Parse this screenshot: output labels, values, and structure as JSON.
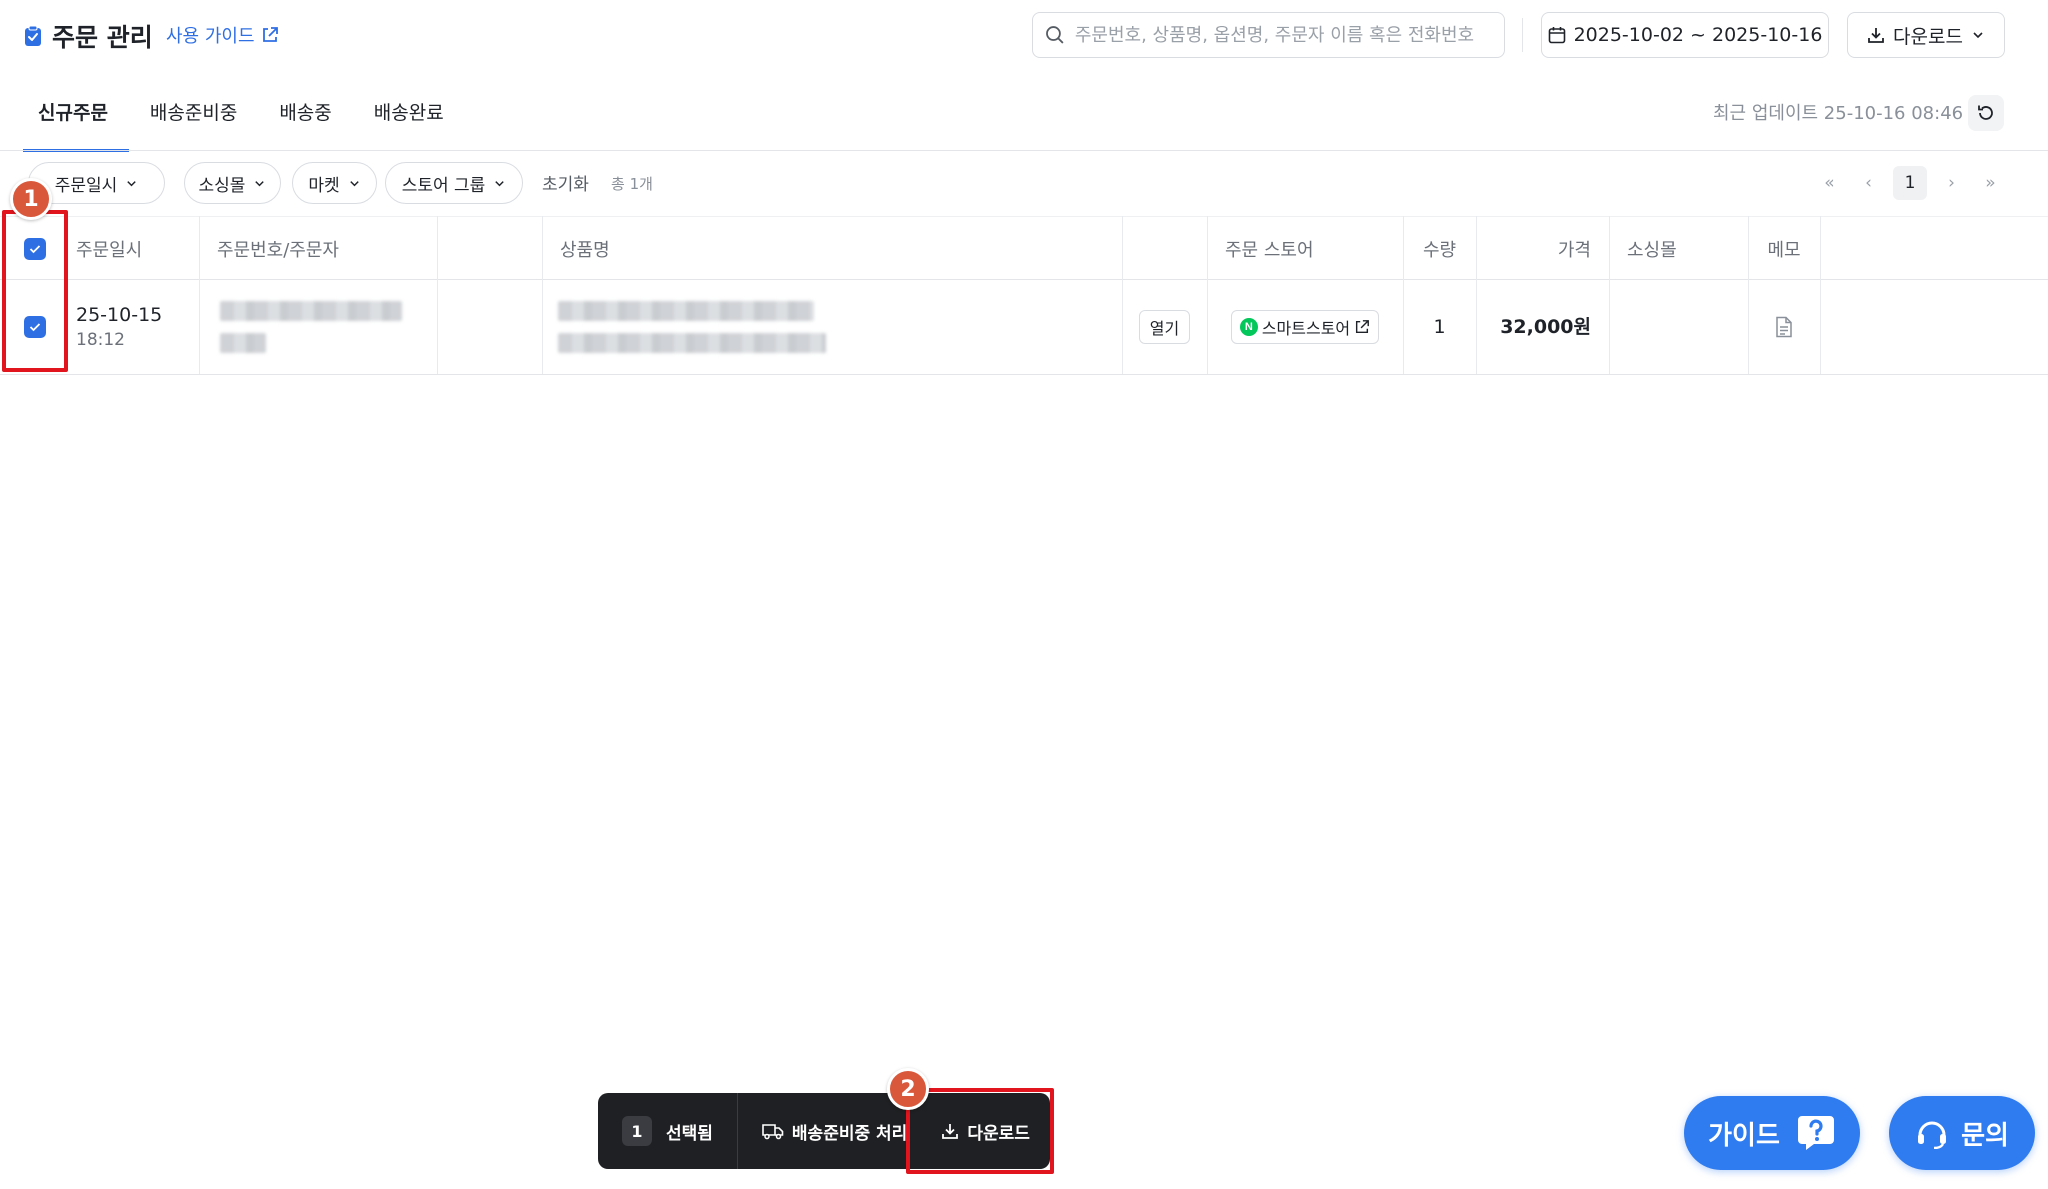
{
  "header": {
    "title": "주문 관리",
    "guide_link": "사용 가이드",
    "search_placeholder": "주문번호, 상품명, 옵션명, 주문자 이름 혹은 전화번호",
    "date_range": "2025-10-02 ~ 2025-10-16",
    "download_label": "다운로드"
  },
  "tabs": [
    {
      "label": "신규주문",
      "active": true
    },
    {
      "label": "배송준비중",
      "active": false
    },
    {
      "label": "배송중",
      "active": false
    },
    {
      "label": "배송완료",
      "active": false
    }
  ],
  "last_updated": "최근 업데이트 25-10-16 08:46",
  "filters": {
    "chips": [
      "주문일시",
      "소싱몰",
      "마켓",
      "스토어 그룹"
    ],
    "reset_label": "초기화",
    "total_label": "총 1개"
  },
  "pagination": {
    "current_page": "1",
    "first": "«",
    "prev": "‹",
    "next": "›",
    "last": "»"
  },
  "table": {
    "columns": [
      "주문일시",
      "주문번호/주문자",
      "",
      "상품명",
      "",
      "주문 스토어",
      "수량",
      "가격",
      "소싱몰",
      "메모"
    ],
    "rows": [
      {
        "date": "25-10-15",
        "time": "18:12",
        "open_label": "열기",
        "store": "스마트스토어",
        "store_logo": "N",
        "quantity": "1",
        "price": "32,000원"
      }
    ]
  },
  "action_bar": {
    "selected_count": "1",
    "selected_label": "선택됨",
    "ship_prep_label": "배송준비중 처리",
    "download_label": "다운로드"
  },
  "annotations": {
    "marker1": "1",
    "marker2": "2"
  },
  "floating": {
    "guide_label": "가이드",
    "ask_label": "문의"
  },
  "colors": {
    "accent": "#2f6fe4",
    "annotation_red": "#e0151d",
    "marker": "#d9573a",
    "naver_green": "#03c75a",
    "action_bar": "#1f2023"
  }
}
